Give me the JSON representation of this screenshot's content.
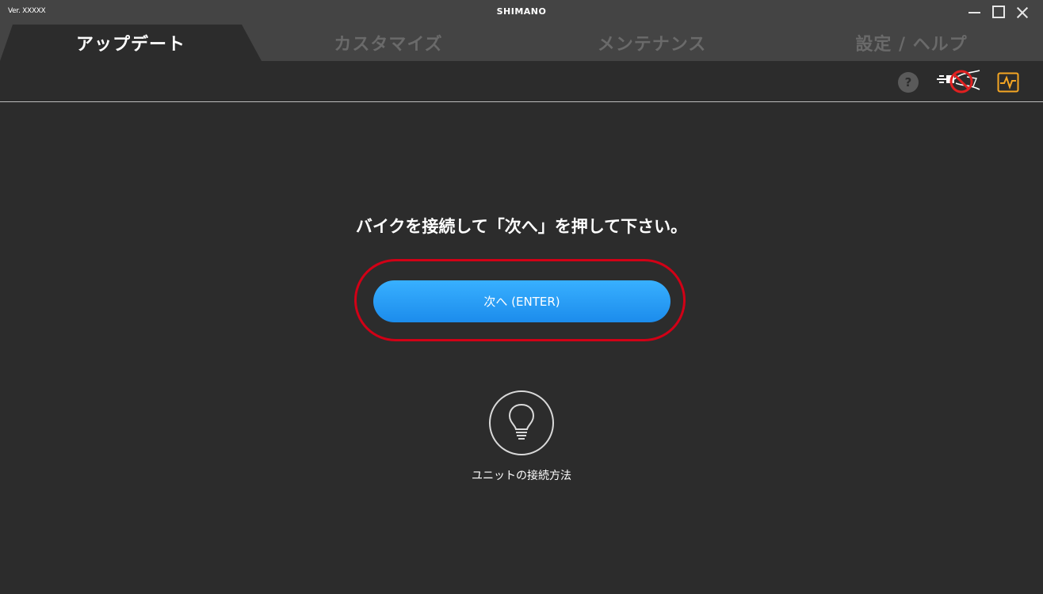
{
  "titlebar": {
    "version": "Ver. XXXXX",
    "brand": "SHIMANO",
    "controls": [
      "minimize-icon",
      "maximize-icon",
      "close-icon"
    ]
  },
  "tabs": [
    {
      "label": "アップデート",
      "active": true
    },
    {
      "label": "カスタマイズ",
      "active": false
    },
    {
      "label": "メンテナンス",
      "active": false
    },
    {
      "label": "設定 / ヘルプ",
      "active": false
    }
  ],
  "toolbar": {
    "help_glyph": "?",
    "icons": [
      "help-icon",
      "bike-disconnected-icon",
      "monitor-icon"
    ],
    "accent_color": "#f5a623",
    "alert_color": "#e02020"
  },
  "main": {
    "prompt": "バイクを接続して「次へ」を押して下さい。",
    "next_button": "次へ (ENTER)",
    "tip_label": "ユニットの接続方法",
    "tip_icon": "lightbulb-icon",
    "highlight_color": "#d10016",
    "button_color": "#2a9df4"
  }
}
